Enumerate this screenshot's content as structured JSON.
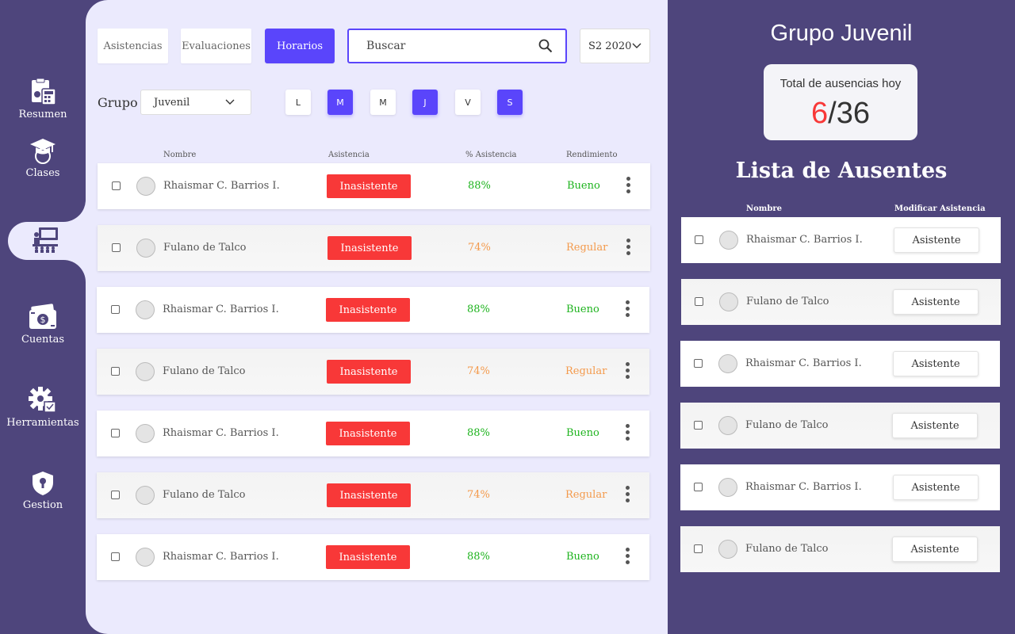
{
  "sidebar": {
    "items": [
      {
        "label": "Resumen",
        "icon": "calculator-clipboard-icon"
      },
      {
        "label": "Clases",
        "icon": "graduation-cap-icon"
      },
      {
        "label": "",
        "icon": "classroom-icon"
      },
      {
        "label": "Cuentas",
        "icon": "money-icon"
      },
      {
        "label": "Herramientas",
        "icon": "gear-icon"
      },
      {
        "label": "Gestion",
        "icon": "shield-icon"
      }
    ]
  },
  "tabs": [
    {
      "label": "Asistencias"
    },
    {
      "label": "Evaluaciones"
    },
    {
      "label": "Horarios"
    }
  ],
  "search": {
    "placeholder": "Buscar"
  },
  "semester": {
    "value": "S2 2020"
  },
  "group": {
    "label": "Grupo",
    "value": "Juvenil"
  },
  "days": [
    {
      "label": "L",
      "active": false
    },
    {
      "label": "M",
      "active": true
    },
    {
      "label": "M",
      "active": false
    },
    {
      "label": "J",
      "active": true
    },
    {
      "label": "V",
      "active": false
    },
    {
      "label": "S",
      "active": true
    }
  ],
  "table": {
    "headers": [
      "Nombre",
      "Asistencia",
      "% Asistencia",
      "Rendimiento"
    ],
    "rows": [
      {
        "name": "Rhaismar C. Barrios I.",
        "status": "Inasistente",
        "pct": "88%",
        "perf": "Bueno"
      },
      {
        "name": "Fulano de Talco",
        "status": "Inasistente",
        "pct": "74%",
        "perf": "Regular"
      },
      {
        "name": "Rhaismar C. Barrios I.",
        "status": "Inasistente",
        "pct": "88%",
        "perf": "Bueno"
      },
      {
        "name": "Fulano de Talco",
        "status": "Inasistente",
        "pct": "74%",
        "perf": "Regular"
      },
      {
        "name": "Rhaismar C. Barrios I.",
        "status": "Inasistente",
        "pct": "88%",
        "perf": "Bueno"
      },
      {
        "name": "Fulano de Talco",
        "status": "Inasistente",
        "pct": "74%",
        "perf": "Regular"
      },
      {
        "name": "Rhaismar C. Barrios I.",
        "status": "Inasistente",
        "pct": "88%",
        "perf": "Bueno"
      }
    ]
  },
  "panel": {
    "title": "Grupo Juvenil",
    "card_title": "Total de ausencias hoy",
    "absences": "6",
    "separator": "/",
    "total": "36",
    "list_title": "Lista de Ausentes",
    "headers": [
      "Nombre",
      "Modificar Asistencia"
    ],
    "rows": [
      {
        "name": "Rhaismar C. Barrios I.",
        "action": "Asistente"
      },
      {
        "name": "Fulano de Talco",
        "action": "Asistente"
      },
      {
        "name": "Rhaismar C. Barrios I.",
        "action": "Asistente"
      },
      {
        "name": "Fulano de Talco",
        "action": "Asistente"
      },
      {
        "name": "Rhaismar C. Barrios I.",
        "action": "Asistente"
      },
      {
        "name": "Fulano de Talco",
        "action": "Asistente"
      }
    ]
  },
  "colors": {
    "sidebar_bg": "#4e457c",
    "main_bg": "#ebeafd",
    "accent": "#5a45fb",
    "absent_red": "#f83838",
    "good_green": "#1db31d",
    "regular_orange": "#f49a4c"
  }
}
